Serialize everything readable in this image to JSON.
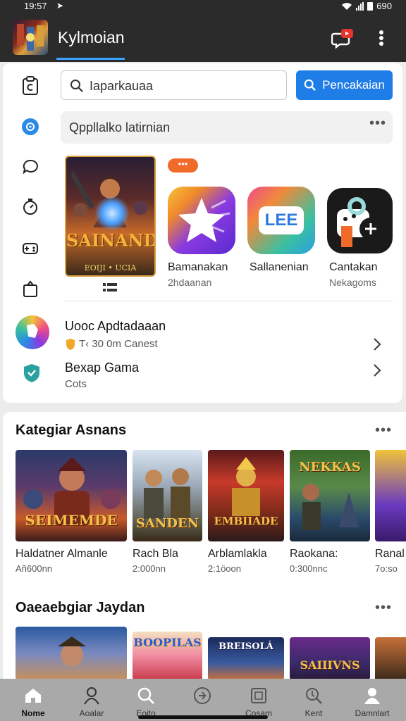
{
  "status_bar": {
    "time": "19:57",
    "battery_label": "690"
  },
  "header": {
    "title": "Kylmoian",
    "colors": {
      "background": "#2b2b2b",
      "accent": "#3aa3ff"
    }
  },
  "search": {
    "value": "Iaparkauaa",
    "button_label": "Pencakaian"
  },
  "suggestion": {
    "text": "Qppllalko latirnian"
  },
  "featured": {
    "poster_title": "SAINANDE",
    "poster_sub": "EOIJI • UCIA",
    "badge": "•••"
  },
  "apps": [
    {
      "name": "Bamanakan",
      "sub": "2hdaanan",
      "icon": "star-app-icon"
    },
    {
      "name": "Sallanenian",
      "sub": "",
      "icon_text": "LEE"
    },
    {
      "name": "Cantakan",
      "sub": "Nekagoms",
      "icon": "puzzle-app-icon"
    }
  ],
  "list": [
    {
      "title": "Uooc Apdtadaaan",
      "sub": "T‹ 30 0m Canest"
    },
    {
      "title": "Bexap Gama",
      "sub": "Cots"
    }
  ],
  "sections": [
    {
      "title": "Kategiar Asnans",
      "games": [
        {
          "name": "Haldatner Almanle",
          "sub": "Añ600nn",
          "art_title": "SEIMEMDE"
        },
        {
          "name": "Rach Bla",
          "sub": "2:000nn",
          "art_title": "SANDEN"
        },
        {
          "name": "Arblamlakla",
          "sub": "2:1öoon",
          "art_title": "EMBIIADE"
        },
        {
          "name": "Raokana:",
          "sub": "0:300nnc",
          "art_title": "NEKKAS"
        },
        {
          "name": "Ranal",
          "sub": "7o:so",
          "art_title": ""
        }
      ]
    },
    {
      "title": "Oaeaebgiar Jaydan",
      "games": [
        {
          "name": "",
          "sub": "",
          "art_title": ""
        },
        {
          "name": "",
          "sub": "",
          "art_title": "BOOPILAS"
        },
        {
          "name": "",
          "sub": "",
          "art_title": "BREISOLÁ"
        },
        {
          "name": "",
          "sub": "",
          "art_title": "SAIIIVNS"
        },
        {
          "name": "",
          "sub": "",
          "art_title": ""
        }
      ]
    }
  ],
  "bottom_nav": [
    {
      "label": "Nome",
      "icon": "home-icon",
      "active": true
    },
    {
      "label": "Aoalar",
      "icon": "person-icon"
    },
    {
      "label": "Eoito",
      "icon": "search-icon"
    },
    {
      "label": "",
      "icon": "compass-icon"
    },
    {
      "label": "Cosam",
      "icon": "book-icon"
    },
    {
      "label": "Kent",
      "icon": "magnifier-icon"
    },
    {
      "label": "Damnlart",
      "icon": "account-icon"
    }
  ],
  "colors": {
    "primary_button": "#1e7de6",
    "badge": "#f06a2a",
    "nav_background": "#a9a9a9"
  }
}
